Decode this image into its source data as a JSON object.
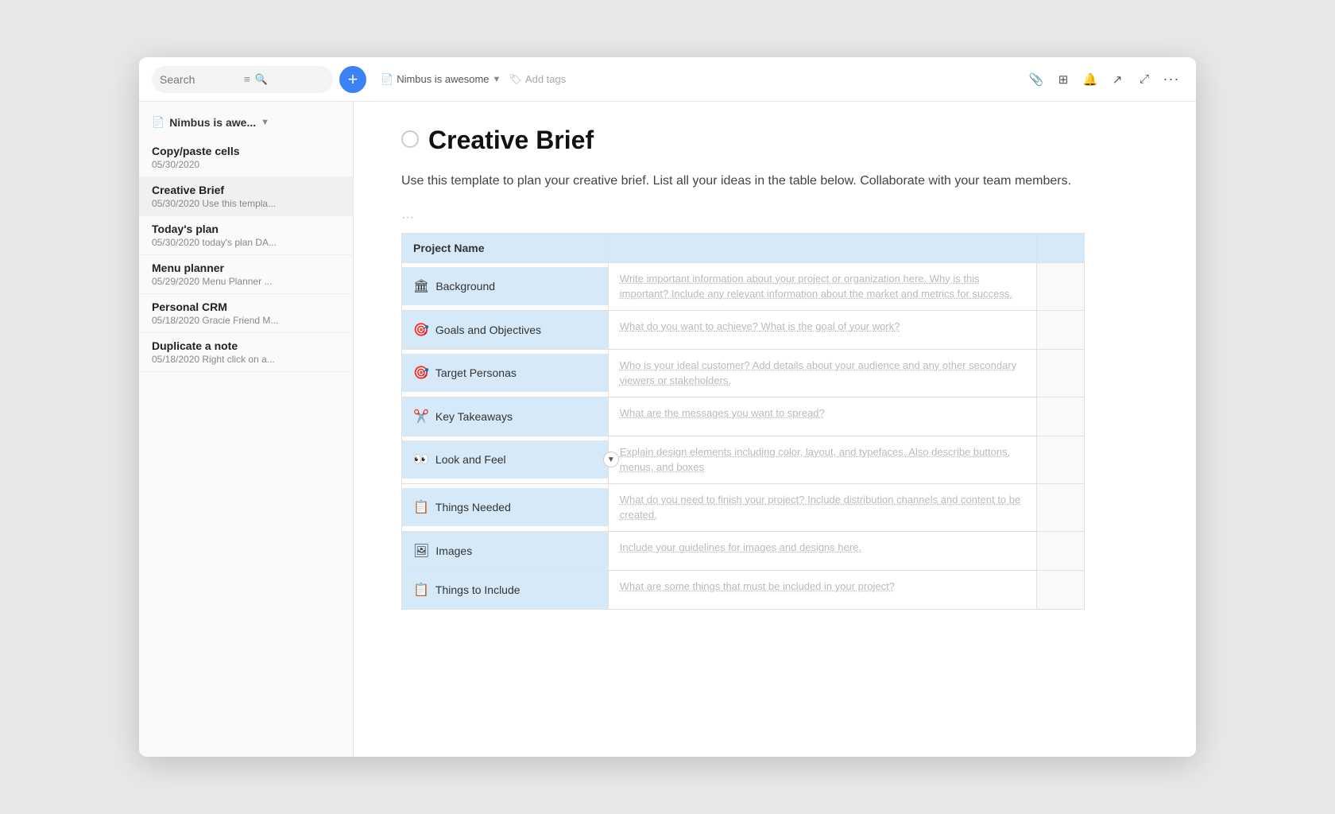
{
  "window": {
    "title": "Creative Brief"
  },
  "topbar": {
    "search_placeholder": "Search",
    "breadcrumb_icon": "📄",
    "breadcrumb_name": "Nimbus is awesome",
    "breadcrumb_chevron": "▼",
    "add_tags_icon": "🏷",
    "add_tags_label": "Add tags",
    "actions": [
      {
        "name": "attachment-icon",
        "icon": "📎"
      },
      {
        "name": "grid-icon",
        "icon": "⊞"
      },
      {
        "name": "bell-icon",
        "icon": "🔔"
      },
      {
        "name": "share-icon",
        "icon": "↗"
      },
      {
        "name": "expand-icon",
        "icon": "⤢"
      },
      {
        "name": "more-icon",
        "icon": "···"
      }
    ]
  },
  "sidebar": {
    "workspace_name": "Nimbus is awe...",
    "items": [
      {
        "title": "Copy/paste cells",
        "meta": "05/30/2020"
      },
      {
        "title": "Creative Brief",
        "meta": "05/30/2020 Use this templa..."
      },
      {
        "title": "Today's plan",
        "meta": "05/30/2020 today's plan DA..."
      },
      {
        "title": "Menu planner",
        "meta": "05/29/2020 Menu Planner ..."
      },
      {
        "title": "Personal CRM",
        "meta": "05/18/2020 Gracie Friend M..."
      },
      {
        "title": "Duplicate a note",
        "meta": "05/18/2020 Right click on a..."
      }
    ]
  },
  "doc": {
    "title": "Creative Brief",
    "description": "Use this template to plan your creative brief. List all your ideas in the table below. Collaborate with your team members.",
    "block_menu": "···"
  },
  "table": {
    "header": {
      "col1": "Project Name",
      "col2": "",
      "col3": ""
    },
    "rows": [
      {
        "icon": "🏛",
        "label": "Background",
        "hint": "Write important information about your project or organization here. Why is this important? Include any relevant information about the market and metrics for success."
      },
      {
        "icon": "🎯",
        "label": "Goals and Objectives",
        "hint": "What do you want to achieve? What is the goal of your work?"
      },
      {
        "icon": "🎯",
        "label": "Target Personas",
        "hint": "Who is your ideal customer? Add details about your audience and any other secondary viewers or stakeholders."
      },
      {
        "icon": "✂️",
        "label": "Key Takeaways",
        "hint": "What are the messages you want to spread?"
      },
      {
        "icon": "👀",
        "label": "Look and Feel",
        "hint": "Explain design elements including color, layout, and typefaces. Also describe buttons, menus, and boxes",
        "has_collapse": true
      },
      {
        "icon": "📋",
        "label": "Things Needed",
        "hint": "What do you need to finish your project? Include distribution channels and content to be created."
      },
      {
        "icon": "🖼",
        "label": "Images",
        "hint": "Include your guidelines for images and designs here."
      },
      {
        "icon": "📋",
        "label": "Things to Include",
        "hint": "What are some things that must be included in your project?"
      }
    ]
  }
}
